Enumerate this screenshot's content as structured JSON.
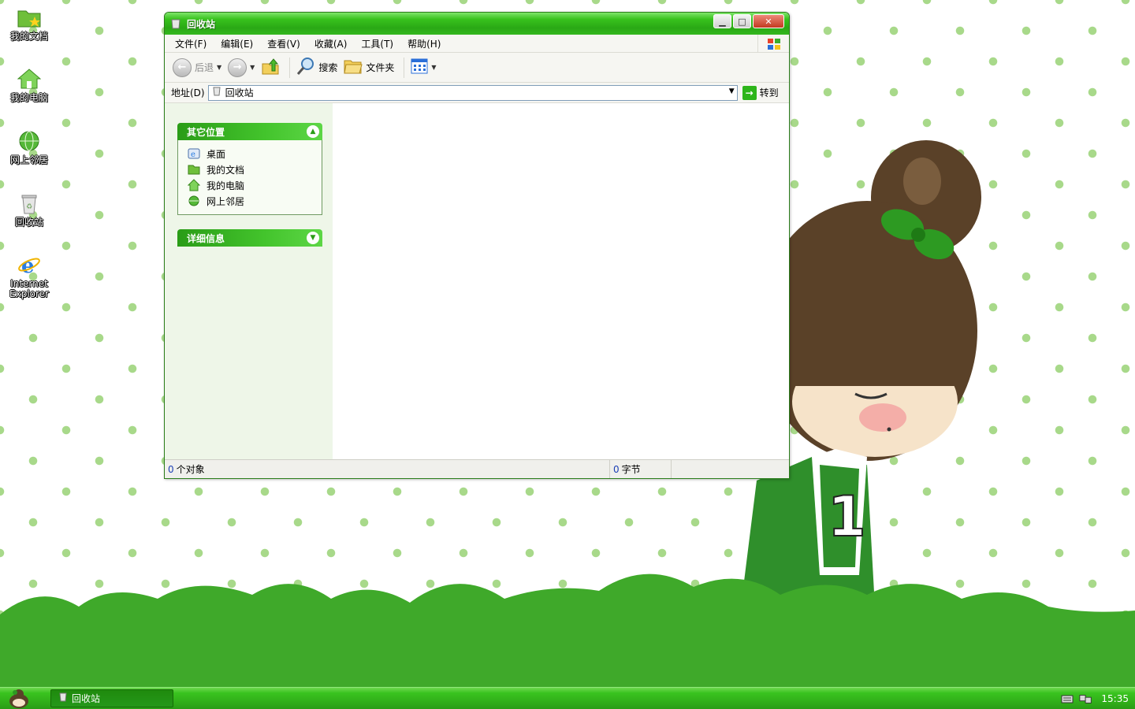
{
  "desktop": {
    "icons": [
      {
        "label": "我的文档",
        "icon": "folder-star-icon"
      },
      {
        "label": "我的电脑",
        "icon": "computer-house-icon"
      },
      {
        "label": "网上邻居",
        "icon": "network-globe-icon"
      },
      {
        "label": "回收站",
        "icon": "recycle-bin-icon"
      },
      {
        "label": "Internet Explorer",
        "icon": "internet-explorer-icon"
      }
    ]
  },
  "window": {
    "title": "回收站",
    "menu": [
      "文件(F)",
      "编辑(E)",
      "查看(V)",
      "收藏(A)",
      "工具(T)",
      "帮助(H)"
    ],
    "toolbar": {
      "back_label": "后退",
      "search_label": "搜索",
      "folders_label": "文件夹"
    },
    "address": {
      "label": "地址(D)",
      "value": "回收站",
      "go_label": "转到"
    },
    "sidebar": {
      "other_places": {
        "title": "其它位置",
        "items": [
          {
            "label": "桌面",
            "icon": "desktop-icon"
          },
          {
            "label": "我的文档",
            "icon": "folder-icon"
          },
          {
            "label": "我的电脑",
            "icon": "computer-house-icon"
          },
          {
            "label": "网上邻居",
            "icon": "network-globe-icon"
          }
        ]
      },
      "details": {
        "title": "详细信息"
      }
    },
    "status": {
      "objects_count": "0",
      "objects_label": "个对象",
      "bytes_count": "0",
      "bytes_label": "字节"
    }
  },
  "taskbar": {
    "task_label": "回收站",
    "clock": "15:35"
  },
  "colors": {
    "theme_green": "#38c21d",
    "dot_green": "#a8d98a",
    "hill_green": "#3fa92a"
  }
}
